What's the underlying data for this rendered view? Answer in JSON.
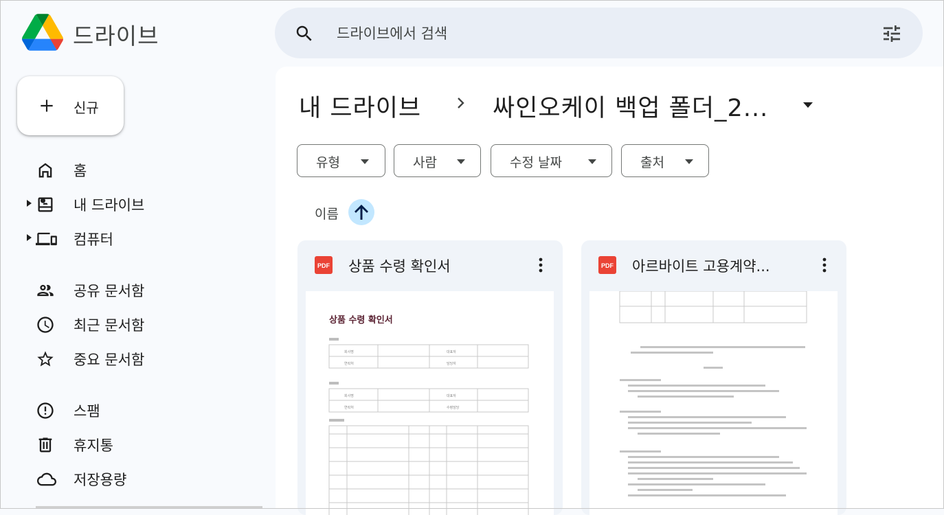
{
  "app": {
    "name": "드라이브"
  },
  "search": {
    "placeholder": "드라이브에서 검색"
  },
  "sidebar": {
    "new_label": "신규",
    "items": [
      {
        "label": "홈",
        "icon": "home-icon"
      },
      {
        "label": "내 드라이브",
        "icon": "my-drive-icon"
      },
      {
        "label": "컴퓨터",
        "icon": "computers-icon"
      },
      {
        "label": "공유 문서함",
        "icon": "shared-icon"
      },
      {
        "label": "최근 문서함",
        "icon": "clock-icon"
      },
      {
        "label": "중요 문서함",
        "icon": "star-icon"
      },
      {
        "label": "스팸",
        "icon": "spam-icon"
      },
      {
        "label": "휴지통",
        "icon": "trash-icon"
      },
      {
        "label": "저장용량",
        "icon": "cloud-icon"
      }
    ]
  },
  "breadcrumb": {
    "root": "내 드라이브",
    "current": "싸인오케이 백업 폴더_2..."
  },
  "filters": [
    {
      "label": "유형"
    },
    {
      "label": "사람"
    },
    {
      "label": "수정 날짜"
    },
    {
      "label": "출처"
    }
  ],
  "sort": {
    "label": "이름"
  },
  "files": [
    {
      "name": "상품 수령 확인서",
      "type": "pdf",
      "preview": {
        "doc_title": "상품 수령 확인서",
        "rows1": [
          "회사명",
          "대표자",
          "연락처",
          "담당자"
        ],
        "rows2": [
          "회사명",
          "대표자",
          "연락처",
          "수령담당"
        ]
      }
    },
    {
      "name": "아르바이트 고용계약...",
      "type": "pdf"
    }
  ],
  "colors": {
    "accent": "#0b57d0",
    "sort_bg": "#c2e7ff",
    "pdf": "#ea4335",
    "panel": "#ffffff",
    "bg": "#f8fafd"
  }
}
